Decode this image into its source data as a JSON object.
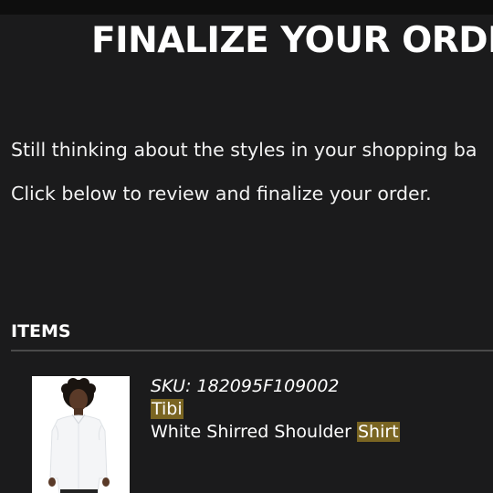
{
  "header": {
    "title": "FINALIZE YOUR ORDE"
  },
  "intro": {
    "line1": "Still thinking about the styles in your shopping ba",
    "line2": "Click below to review and finalize your order."
  },
  "items_section": {
    "heading": "ITEMS",
    "items": [
      {
        "sku_text": "SKU: 182095F109002",
        "brand": "Tibi",
        "name_prefix": "White Shirred Shoulder ",
        "name_highlight": "Shirt",
        "image_icon": "product-photo"
      }
    ]
  },
  "colors": {
    "background": "#1b1b1c",
    "highlight": "#7a6522",
    "divider": "#4a4a4a"
  }
}
